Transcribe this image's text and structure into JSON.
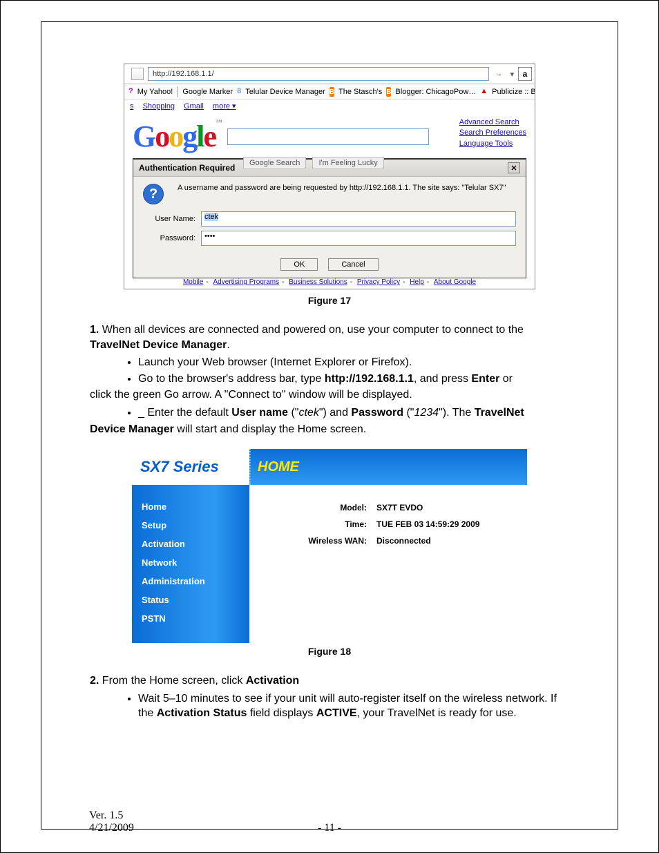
{
  "figure17": {
    "url": "http://192.168.1.1/",
    "go_arrow": "→",
    "amazon_glyph": "a",
    "bookmarks": {
      "my_yahoo": "My Yahoo!",
      "google_marker": "Google Marker",
      "telular": "Telular Device Manager",
      "stasch": "The Stasch's",
      "blogger": "Blogger: ChicagoPow…",
      "publicize": "Publicize :: Buz"
    },
    "toplinks": {
      "s": "s",
      "shopping": "Shopping",
      "gmail": "Gmail",
      "more": "more ▾"
    },
    "search_btn": "Google Search",
    "lucky_btn": "I'm Feeling Lucky",
    "right_links": {
      "adv": "Advanced Search",
      "pref": "Search Preferences",
      "lang": "Language Tools"
    },
    "dialog": {
      "title": "Authentication Required",
      "close": "✕",
      "message": "A username and password are being requested by http://192.168.1.1. The site says: \"Telular SX7\"",
      "user_label": "User Name:",
      "user_value": "ctek",
      "pass_label": "Password:",
      "pass_value": "••••",
      "ok": "OK",
      "cancel": "Cancel"
    },
    "footer_links": [
      "Mobile",
      "Advertising Programs",
      "Business Solutions",
      "Privacy Policy",
      "Help",
      "About Google"
    ],
    "caption": "Figure 17"
  },
  "body": {
    "p1a": "1.",
    "p1b": " When all devices are connected and powered on, use your computer to connect to the ",
    "p1c": "TravelNet Device Manager",
    "p1d": ".",
    "b1": "Launch your Web browser (Internet Explorer or Firefox).",
    "b2a": "Go to the browser's address bar, type ",
    "b2b": "http://192.168.1.1",
    "b2c": ", and press ",
    "b2d": "Enter",
    "b2e": " or",
    "b2tail": "click the green Go arrow. A \"Connect to\" window will be displayed.",
    "b3a": "_ Enter the default ",
    "b3b": "User name",
    "b3c": " (\"",
    "b3d": "ctek",
    "b3e": "\") and ",
    "b3f": "Password",
    "b3g": " (\"",
    "b3h": "1234",
    "b3i": "\"). The ",
    "b3j": "TravelNet",
    "b3tail1": "Device Manager",
    "b3tail2": " will start and display the Home screen."
  },
  "figure18": {
    "brand": "SX7 Series",
    "banner": "HOME",
    "nav": [
      "Home",
      "Setup",
      "Activation",
      "Network",
      "Administration",
      "Status",
      "PSTN"
    ],
    "rows": [
      {
        "label": "Model:",
        "value": "SX7T EVDO"
      },
      {
        "label": "Time:",
        "value": "TUE FEB 03 14:59:29 2009"
      },
      {
        "label": "Wireless WAN:",
        "value": "Disconnected"
      }
    ],
    "caption": "Figure 18"
  },
  "body2": {
    "p2a": "2.",
    "p2b": " From the Home screen, click ",
    "p2c": "Activation",
    "b4a": "Wait 5–10 minutes to see if your unit will auto-register itself on the wireless network. If the ",
    "b4b": "Activation Status",
    "b4c": " field displays ",
    "b4d": "ACTIVE",
    "b4e": ", your TravelNet is ready for use."
  },
  "footer": {
    "version": "Ver. 1.5",
    "date": "4/21/2009",
    "page": "- 11 -"
  }
}
